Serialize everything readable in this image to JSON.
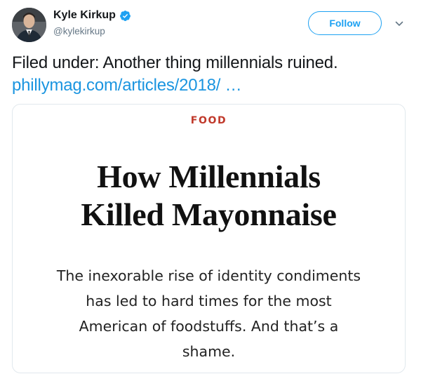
{
  "author": {
    "display_name": "Kyle Kirkup",
    "handle": "@kylekirkup",
    "verified": true
  },
  "actions": {
    "follow_label": "Follow"
  },
  "icons": {
    "verified": "verified-badge-icon",
    "more": "chevron-down-icon"
  },
  "tweet": {
    "text": "Filed under: Another thing millennials ruined.",
    "link_text": "phillymag.com/articles/2018/ …"
  },
  "card": {
    "category": "FOOD",
    "headline_line1": "How Millennials",
    "headline_line2": "Killed Mayonnaise",
    "deck_line1": "The inexorable rise of identity condiments",
    "deck_line2": "has led to hard times for the most",
    "deck_line3": "American of foodstuffs. And that’s a",
    "deck_line4": "shame."
  },
  "colors": {
    "accent": "#1da1f2",
    "link": "#1b95e0",
    "category": "#c0392b",
    "muted": "#657786",
    "border": "#e1e8ed"
  }
}
